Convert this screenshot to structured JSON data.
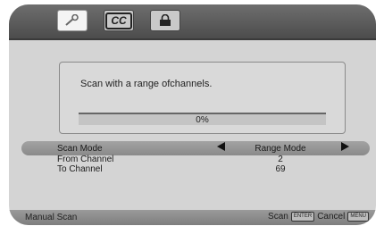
{
  "tabs": [
    {
      "icon": "wrench-icon"
    },
    {
      "label": "CC"
    },
    {
      "icon": "lock-icon"
    }
  ],
  "dialog": {
    "message": "Scan with a range ofchannels.",
    "progress_text": "0%",
    "progress": 0
  },
  "settings": [
    {
      "label": "Scan Mode",
      "value": "Range Mode"
    },
    {
      "label": "From Channel",
      "value": "2"
    },
    {
      "label": "To Channel",
      "value": "69"
    }
  ],
  "footer": {
    "title": "Manual Scan",
    "scan_label": "Scan",
    "scan_key": "ENTER",
    "cancel_label": "Cancel",
    "cancel_key": "MENU"
  }
}
